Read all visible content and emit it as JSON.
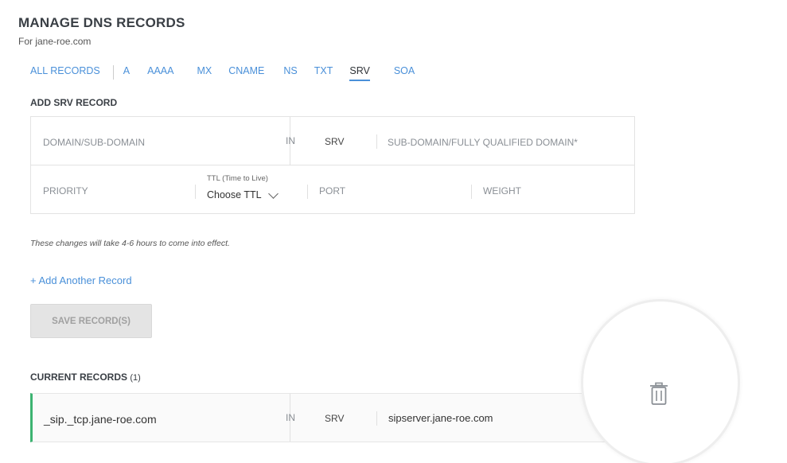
{
  "header": {
    "title": "MANAGE DNS RECORDS",
    "subtitle": "For jane-roe.com"
  },
  "tabs": [
    {
      "label": "ALL RECORDS"
    },
    {
      "label": "A"
    },
    {
      "label": "AAAA"
    },
    {
      "label": "MX"
    },
    {
      "label": "CNAME"
    },
    {
      "label": "NS"
    },
    {
      "label": "TXT"
    },
    {
      "label": "SRV",
      "active": true
    },
    {
      "label": "SOA"
    }
  ],
  "add_section": {
    "title": "ADD SRV RECORD",
    "domain_placeholder": "DOMAIN/SUB-DOMAIN",
    "in_label": "IN",
    "type_label": "SRV",
    "target_placeholder": "SUB-DOMAIN/FULLY QUALIFIED DOMAIN*",
    "priority_placeholder": "PRIORITY",
    "ttl_label": "TTL (Time to Live)",
    "ttl_value": "Choose TTL",
    "port_placeholder": "PORT",
    "weight_placeholder": "WEIGHT"
  },
  "note": "These changes will take 4-6 hours to come into effect.",
  "add_another": "+ Add Another Record",
  "save_button": "SAVE RECORD(S)",
  "current": {
    "title": "CURRENT RECORDS",
    "count": "(1)",
    "records": [
      {
        "domain": "_sip._tcp.jane-roe.com",
        "in": "IN",
        "type": "SRV",
        "target": "sipserver.jane-roe.com"
      }
    ]
  },
  "colors": {
    "accent": "#4a90d9",
    "record_border": "#3cb371",
    "button_disabled": "#e4e4e4"
  }
}
